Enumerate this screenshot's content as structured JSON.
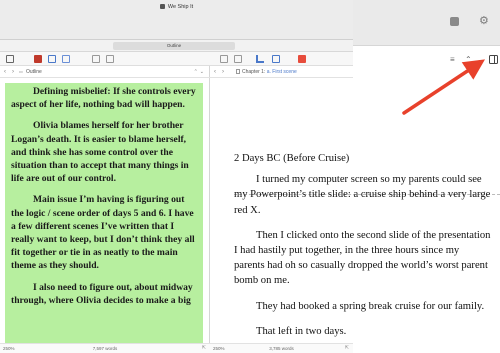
{
  "window": {
    "title": "We Ship It",
    "subtab_label": "Outline"
  },
  "outline_pane": {
    "breadcrumb": "Outline",
    "paragraphs": [
      "Defining misbelief: If she controls every aspect of her life, nothing bad will happen.",
      "Olivia blames herself for her brother Logan’s death. It is easier to blame herself, and think she has some control over the situation than to accept that many things in life are out of our control.",
      "Main issue I’m having is figuring out the logic / scene order of days 5 and 6. I have a few different scenes I’ve written that I really want to keep, but I don’t think they all fit together or tie in as neatly to the main theme as they should.",
      "I also need to figure out, about midway through, where Olivia decides to make a big"
    ],
    "footer": {
      "zoom": "250%",
      "word_count": "7,597 words"
    }
  },
  "editor_pane": {
    "breadcrumb_prefix": "Chapter 1: ",
    "breadcrumb_doc": "a. First scene",
    "heading": "2 Days BC (Before Cruise)",
    "paragraphs": [
      "I turned my computer screen so my parents could see my Powerpoint’s title slide: a cruise ship behind a very large red X.",
      "Then I clicked onto the second slide of the presentation I had hastily put together, in the three hours since my parents had oh so casually dropped the world’s worst parent bomb on me.",
      "They had booked a spring break cruise for our family.",
      "That left in two days."
    ],
    "footer": {
      "zoom": "250%",
      "word_count": "3,785 words"
    }
  },
  "colors": {
    "note_background": "#b7ef9f",
    "annotation_arrow": "#e8412b",
    "link_blue": "#4a78c9"
  },
  "icons": [
    "menu-icon",
    "chevron-up-icon",
    "chevron-down-icon",
    "inspector-toggle-icon",
    "red-arrow-annotation"
  ]
}
